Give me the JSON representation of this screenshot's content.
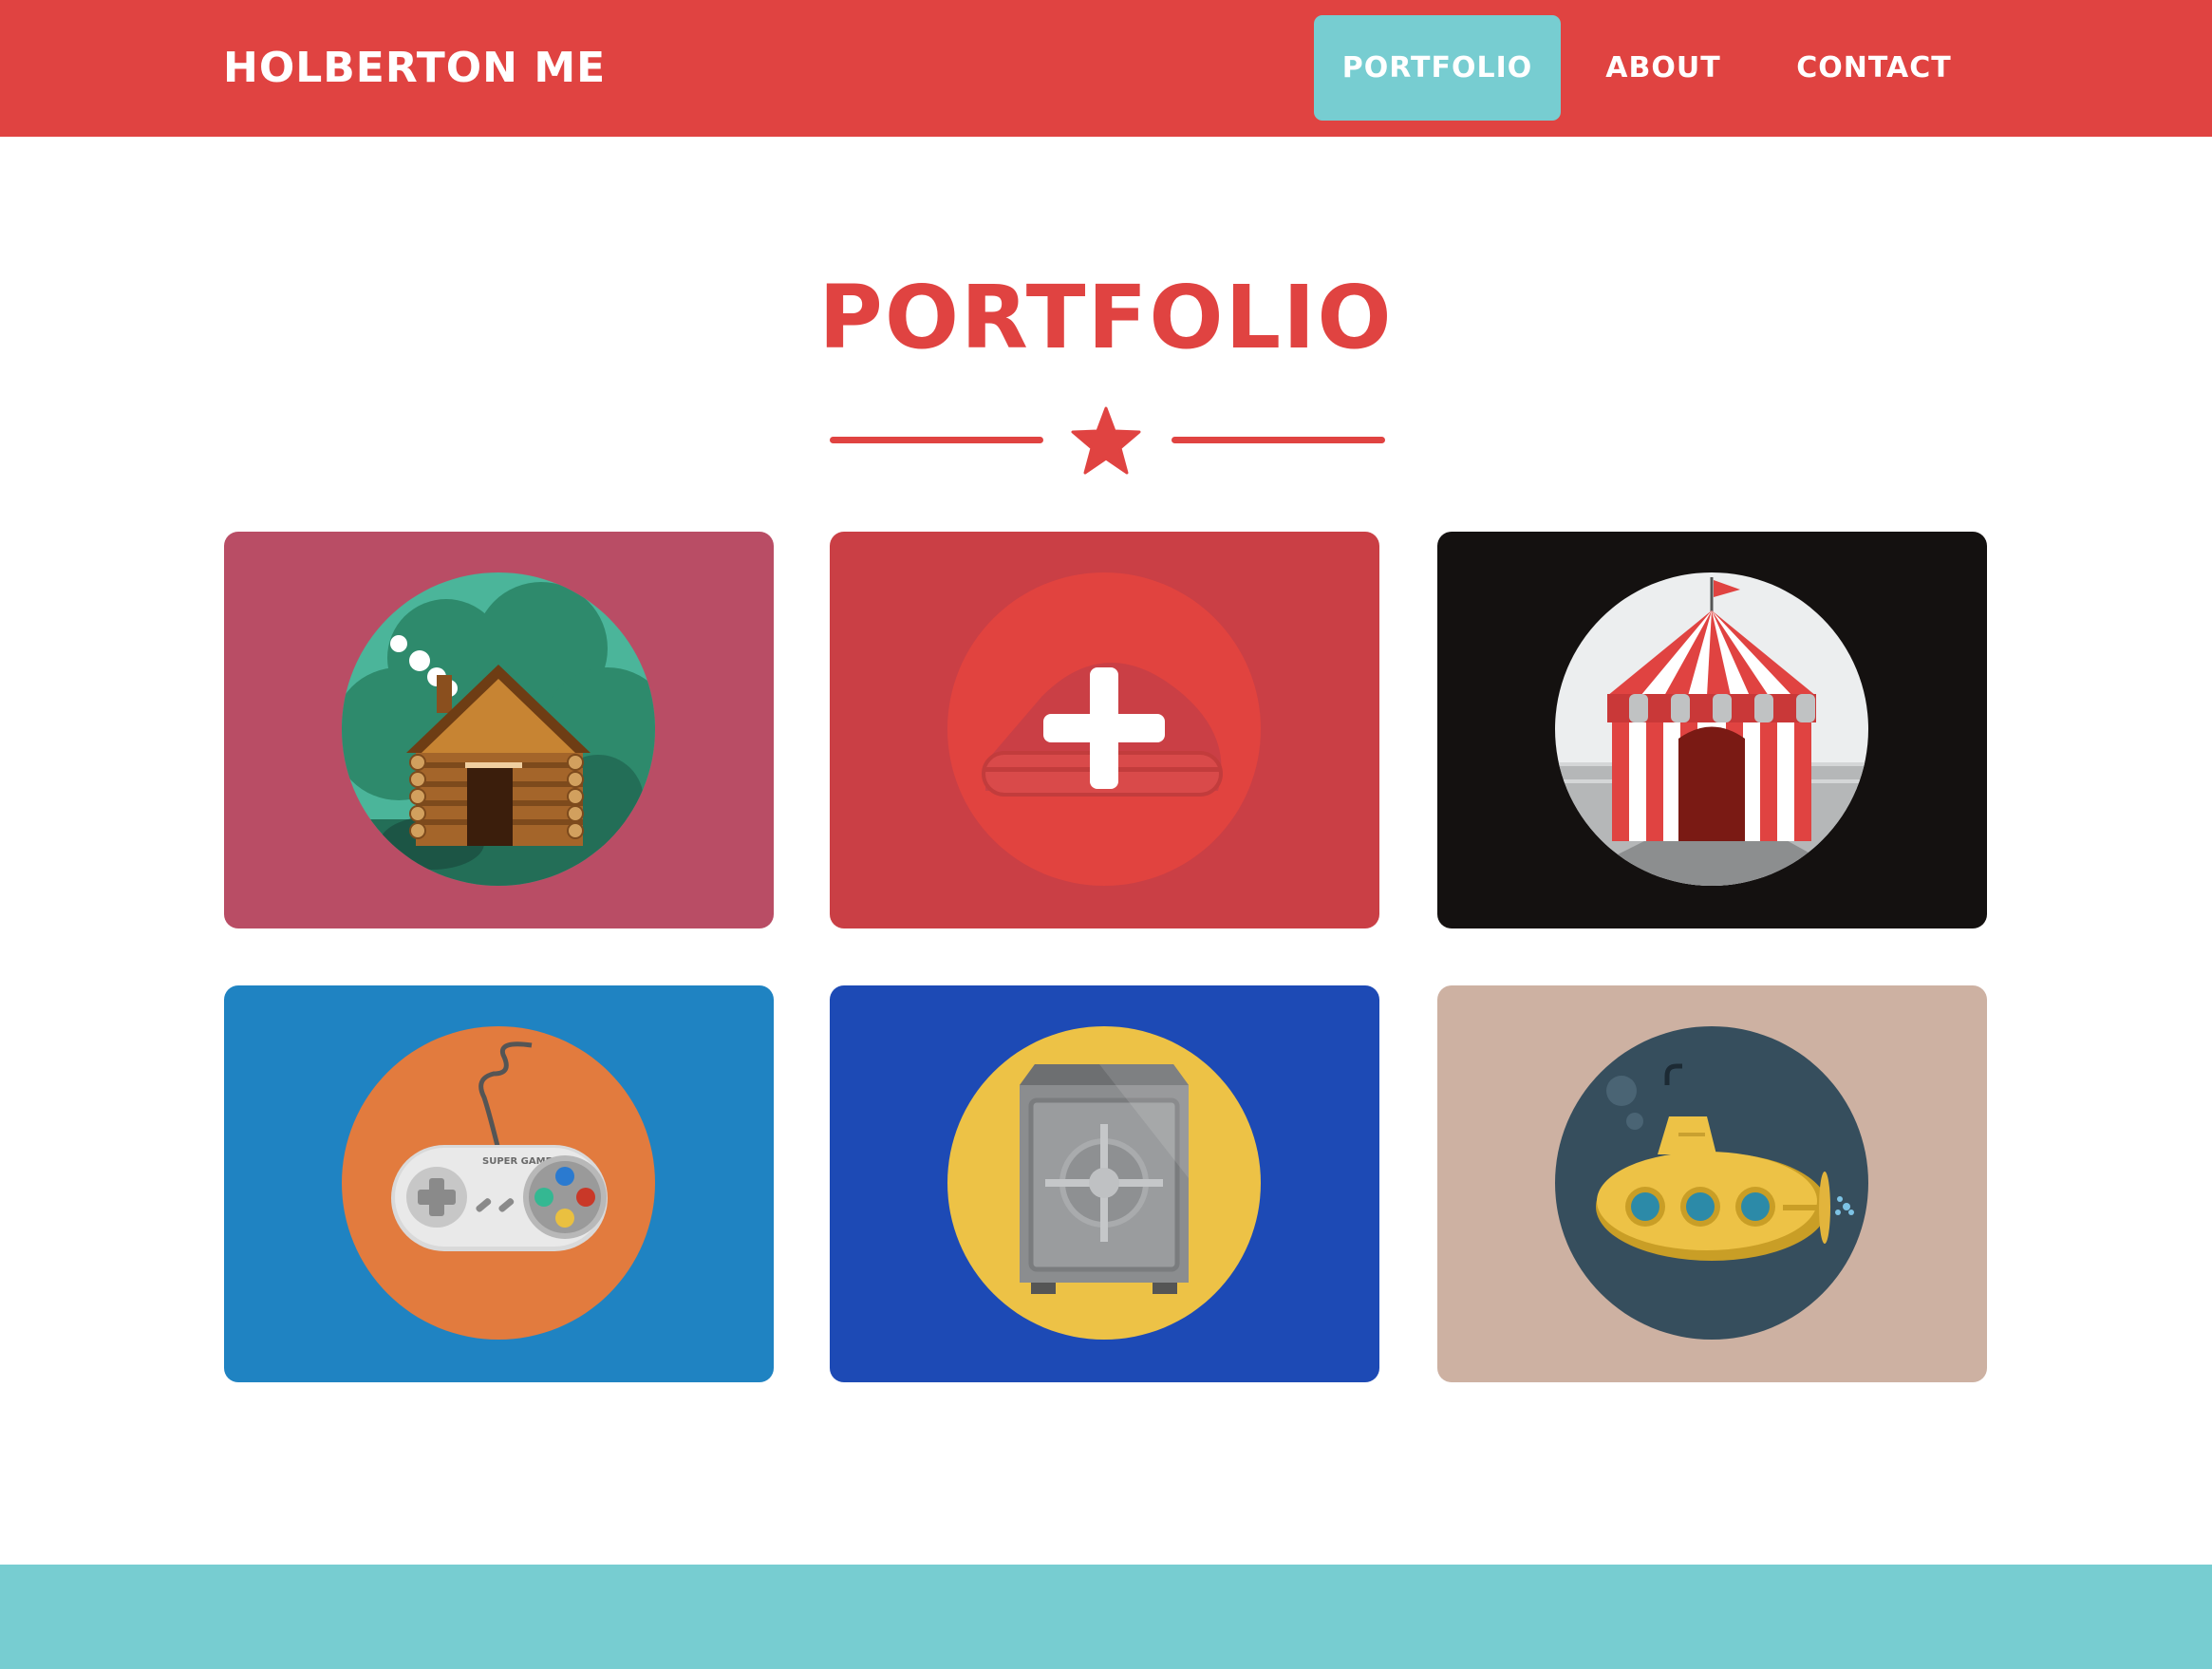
{
  "navbar": {
    "brand": "HOLBERTON ME",
    "items": [
      {
        "label": "PORTFOLIO",
        "active": true
      },
      {
        "label": "ABOUT",
        "active": false
      },
      {
        "label": "CONTACT",
        "active": false
      }
    ]
  },
  "main": {
    "title": "PORTFOLIO",
    "divider_icon": "star-icon"
  },
  "portfolio": [
    {
      "icon": "log-cabin-icon",
      "background": "#b94d65",
      "circle": "#4bb59a"
    },
    {
      "icon": "cake-plus-icon",
      "background": "#ca3f45",
      "circle": "#e1433f"
    },
    {
      "icon": "circus-tent-icon",
      "background": "#141110",
      "circle": "#eceeef"
    },
    {
      "icon": "game-controller-icon",
      "background": "#1f83c2",
      "circle": "#e27b3e"
    },
    {
      "icon": "safe-icon",
      "background": "#1d4ab5",
      "circle": "#edc246"
    },
    {
      "icon": "submarine-icon",
      "background": "#cdb1a2",
      "circle": "#364e5d"
    }
  ],
  "icon_labels": {
    "controller_brand": "SUPER GAME"
  },
  "colors": {
    "primary": "#e04341",
    "accent": "#77cdd1",
    "text_light": "#ffffff"
  }
}
